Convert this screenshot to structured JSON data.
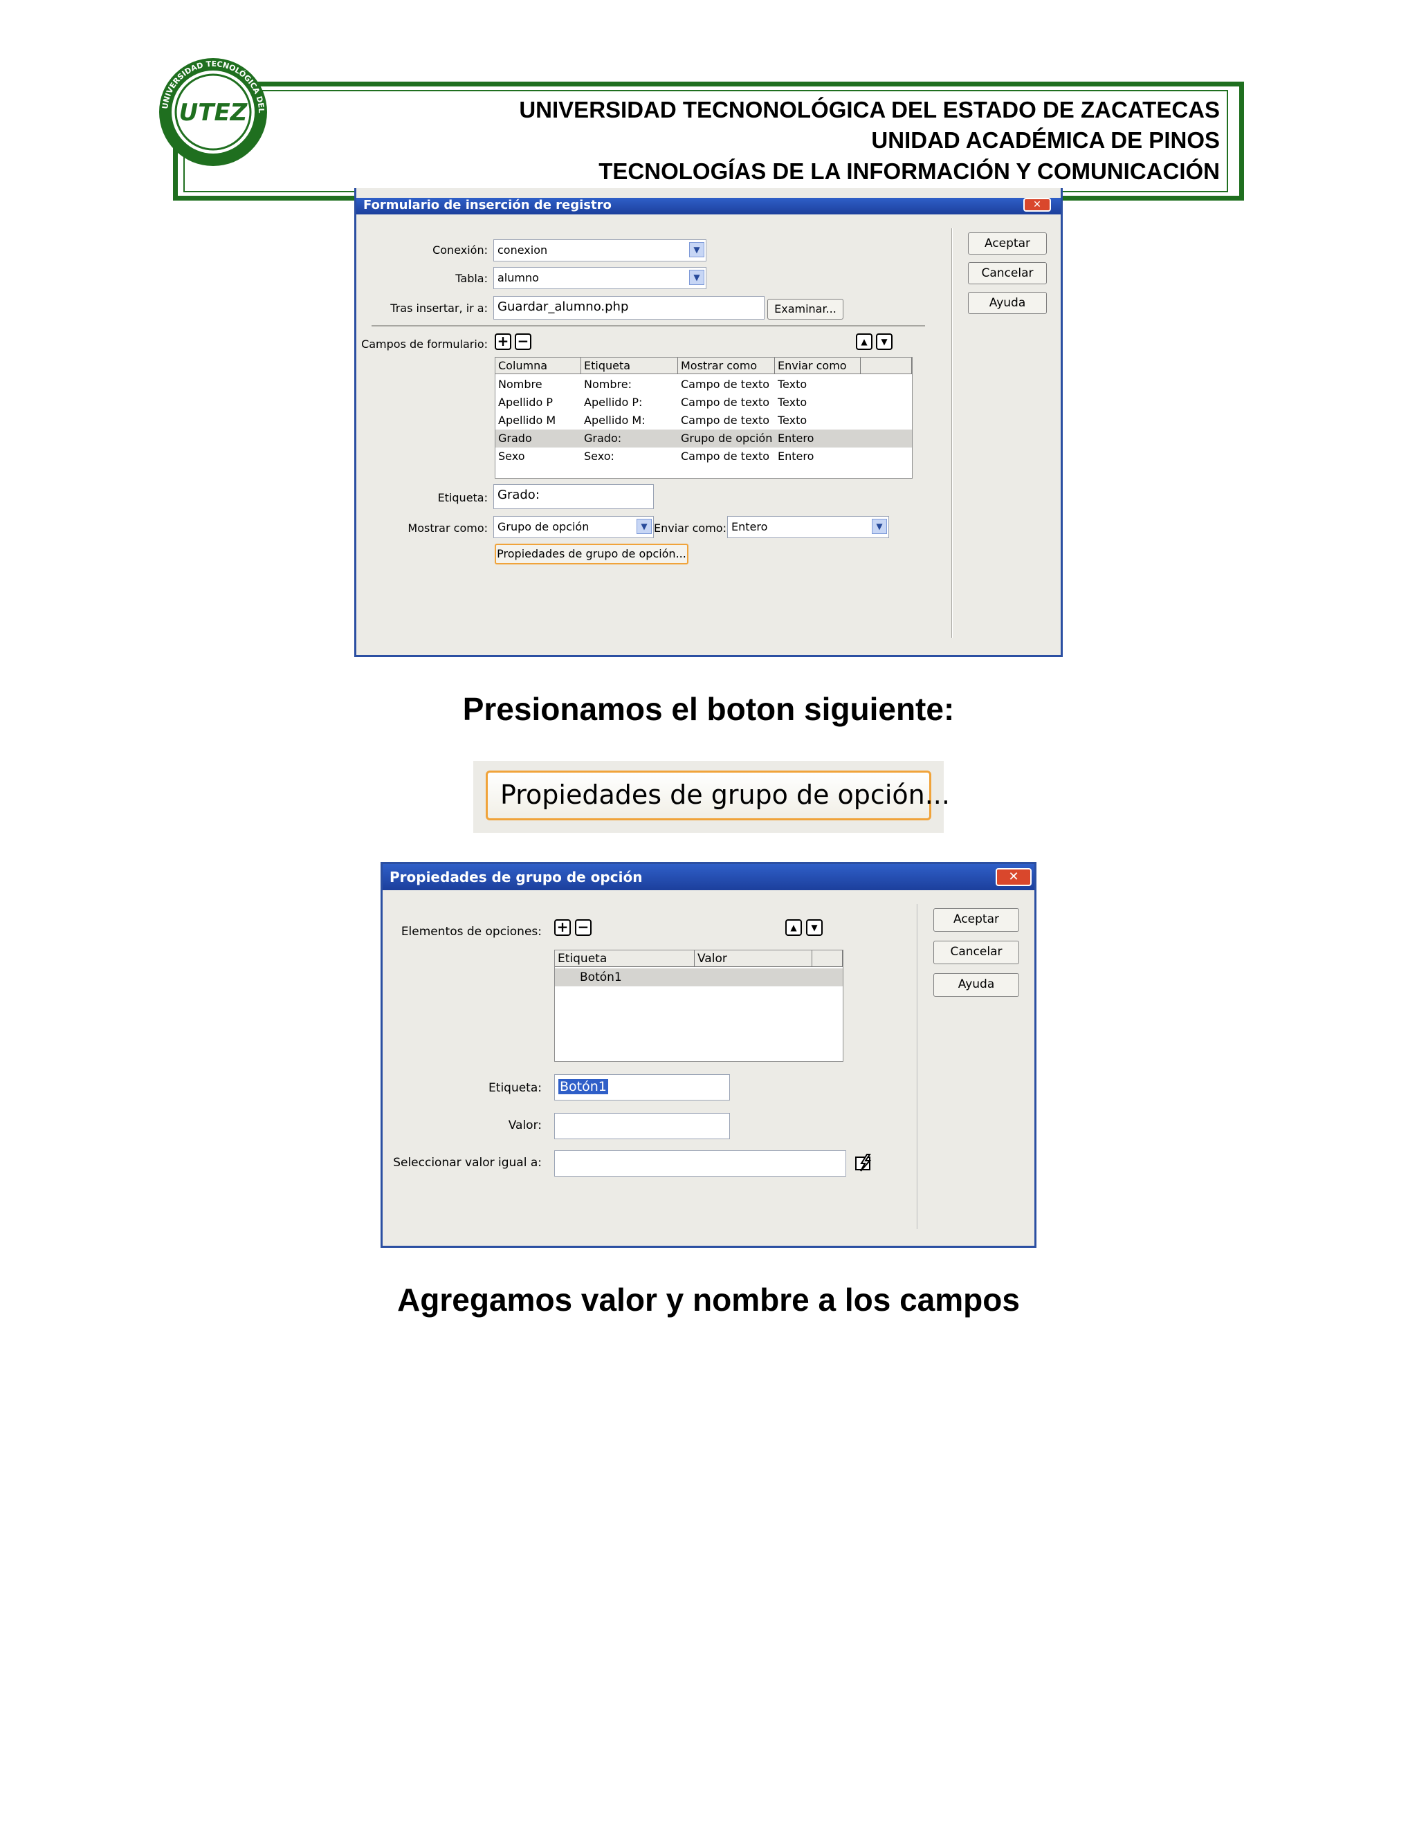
{
  "header": {
    "logo_text": "UTEZ",
    "logo_ring_text": "UNIVERSIDAD TECNOLÓGICA DEL ESTADO DE ZACATECAS",
    "line1": "UNIVERSIDAD TECNONOLÓGICA DEL ESTADO DE ZACATECAS",
    "line2": "UNIDAD ACADÉMICA DE PINOS",
    "line3": "TECNOLOGÍAS DE LA INFORMACIÓN Y COMUNICACIÓN"
  },
  "dialog1": {
    "title": "Formulario de inserción de registro",
    "close": "✕",
    "buttons": {
      "ok": "Aceptar",
      "cancel": "Cancelar",
      "help": "Ayuda"
    },
    "connection_label": "Conexión:",
    "connection_value": "conexion",
    "table_label": "Tabla:",
    "table_value": "alumno",
    "after_insert_label": "Tras insertar, ir a:",
    "after_insert_value": "Guardar_alumno.php",
    "browse": "Examinar...",
    "form_fields_label": "Campos de formulario:",
    "plus": "+",
    "minus": "−",
    "up": "▲",
    "down": "▼",
    "columns": [
      "Columna",
      "Etiqueta",
      "Mostrar como",
      "Enviar como"
    ],
    "rows": [
      [
        "Nombre",
        "Nombre:",
        "Campo de texto",
        "Texto"
      ],
      [
        "Apellido P",
        "Apellido P:",
        "Campo de texto",
        "Texto"
      ],
      [
        "Apellido M",
        "Apellido M:",
        "Campo de texto",
        "Texto"
      ],
      [
        "Grado",
        "Grado:",
        "Grupo de opción",
        "Entero"
      ],
      [
        "Sexo",
        "Sexo:",
        "Campo de texto",
        "Entero"
      ]
    ],
    "selected_row": 3,
    "label_label": "Etiqueta:",
    "label_value": "Grado:",
    "display_label": "Mostrar como:",
    "display_value": "Grupo de opción",
    "submit_label": "Enviar como:",
    "submit_value": "Entero",
    "group_props_button": "Propiedades de grupo de opción..."
  },
  "caption1": "Presionamos el boton siguiente:",
  "big_button": "Propiedades de grupo de opción...",
  "dialog2": {
    "title": "Propiedades de grupo de opción",
    "close": "✕",
    "buttons": {
      "ok": "Aceptar",
      "cancel": "Cancelar",
      "help": "Ayuda"
    },
    "items_label": "Elementos de opciones:",
    "plus": "+",
    "minus": "−",
    "up": "▲",
    "down": "▼",
    "columns": [
      "Etiqueta",
      "Valor"
    ],
    "rows": [
      [
        "Botón1",
        ""
      ]
    ],
    "label_label": "Etiqueta:",
    "label_value": "Botón1",
    "value_label": "Valor:",
    "value_value": "",
    "select_label": "Seleccionar valor igual a:",
    "select_value": "",
    "dynamic_icon": "lightning-icon"
  },
  "caption2": "Agregamos valor y nombre a los campos",
  "colors": {
    "header_green": "#1f6f1f",
    "xp_blue": "#2b4fa2",
    "highlight": "#f0a33a"
  }
}
